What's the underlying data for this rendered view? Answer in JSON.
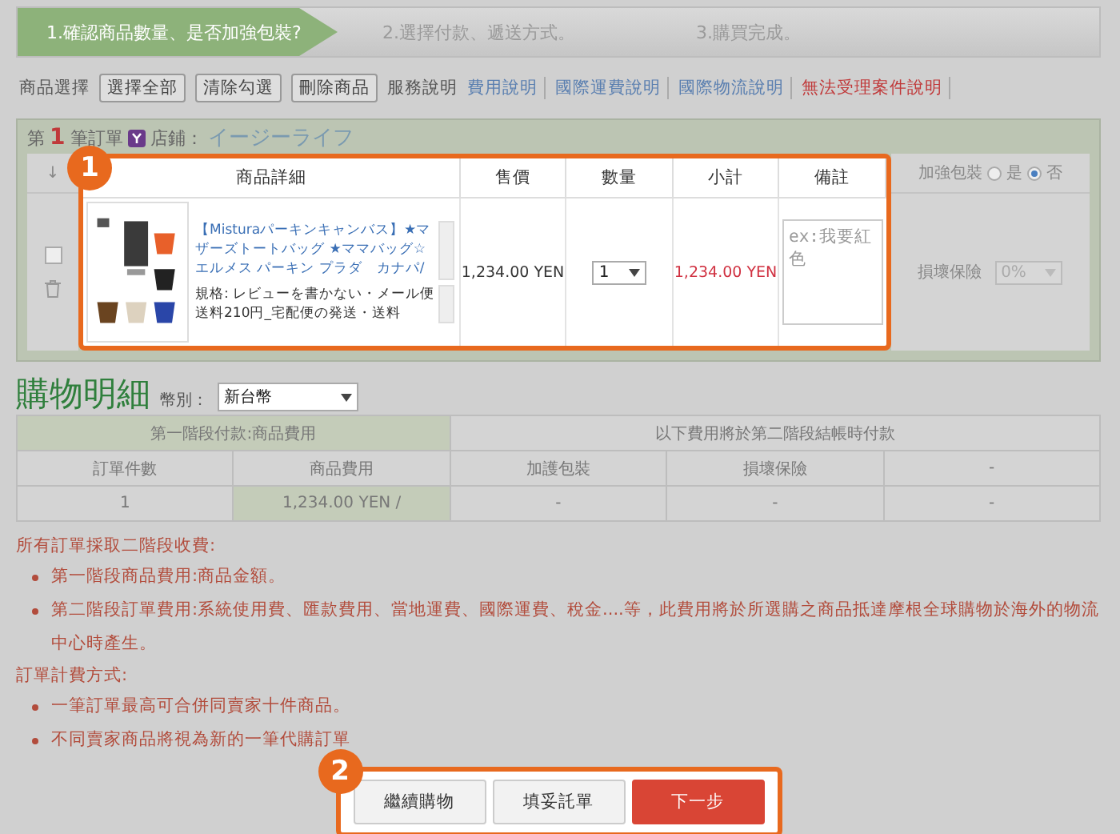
{
  "steps": [
    {
      "label": "1.確認商品數量、是否加強包裝?",
      "selected": true
    },
    {
      "label": "2.選擇付款、遞送方式。",
      "selected": false
    },
    {
      "label": "3.購買完成。",
      "selected": false
    }
  ],
  "toolbar": {
    "label": "商品選擇",
    "buttons": [
      "選擇全部",
      "清除勾選",
      "刪除商品"
    ],
    "service_label": "服務說明",
    "links": [
      {
        "label": "費用說明",
        "kind": "normal"
      },
      {
        "label": "國際運費說明",
        "kind": "normal"
      },
      {
        "label": "國際物流說明",
        "kind": "normal"
      },
      {
        "label": "無法受理案件說明",
        "kind": "warning"
      }
    ]
  },
  "order": {
    "prefix": "第",
    "number": "1",
    "suffix": "筆訂單",
    "store_label": "店鋪：",
    "store_name": "イージーライフ",
    "sort_header": "↓",
    "columns": [
      "商品詳細",
      "售價",
      "數量",
      "小計",
      "備註"
    ],
    "packing": {
      "label": "加強包裝",
      "options": [
        {
          "label": "是",
          "selected": false
        },
        {
          "label": "否",
          "selected": true
        }
      ]
    },
    "item": {
      "checked": false,
      "title": "【Misturaパーキンキャンバス】★マザーズトートバッグ ★ママバッグ☆エルメス パーキン プラダ　カナパ/",
      "spec_label": "規格:",
      "spec": "レビューを書かない・メール便送料210円_宅配便の発送・送料",
      "price": "1,234.00 YEN",
      "quantity": "1",
      "subtotal": "1,234.00 YEN",
      "note_placeholder": "ex:我要紅色",
      "insurance_label": "損壞保險",
      "insurance": {
        "value": "0%",
        "disabled": true
      }
    }
  },
  "callouts": [
    "1",
    "2"
  ],
  "summary": {
    "title": "購物明細",
    "currency_label": "幣別：",
    "currency": "新台幣",
    "groups": [
      {
        "label": "第一階段付款:商品費用",
        "highlight": true
      },
      {
        "label": "以下費用將於第二階段結帳時付款",
        "highlight": false
      }
    ],
    "columns": [
      "訂單件數",
      "商品費用",
      "加護包裝",
      "損壞保險",
      "-"
    ],
    "row": [
      {
        "text": "1",
        "highlight": false
      },
      {
        "text": "1,234.00 YEN /",
        "highlight": true
      },
      {
        "text": "-",
        "highlight": false
      },
      {
        "text": "-",
        "highlight": false
      },
      {
        "text": "-",
        "highlight": false
      }
    ]
  },
  "notes": [
    {
      "heading": "所有訂單採取二階段收費:",
      "items": [
        "第一階段商品費用:商品金額。",
        "第二階段訂單費用:系統使用費、匯款費用、當地運費、國際運費、稅金....等，此費用將於所選購之商品抵達摩根全球購物於海外的物流中心時產生。"
      ]
    },
    {
      "heading": "訂單計費方式:",
      "items": [
        "一筆訂單最高可合併同賣家十件商品。",
        "不同賣家商品將視為新的一筆代購訂單"
      ]
    }
  ],
  "actions": [
    {
      "label": "繼續購物",
      "kind": "secondary"
    },
    {
      "label": "填妥託單",
      "kind": "secondary"
    },
    {
      "label": "下一步",
      "kind": "primary"
    }
  ]
}
